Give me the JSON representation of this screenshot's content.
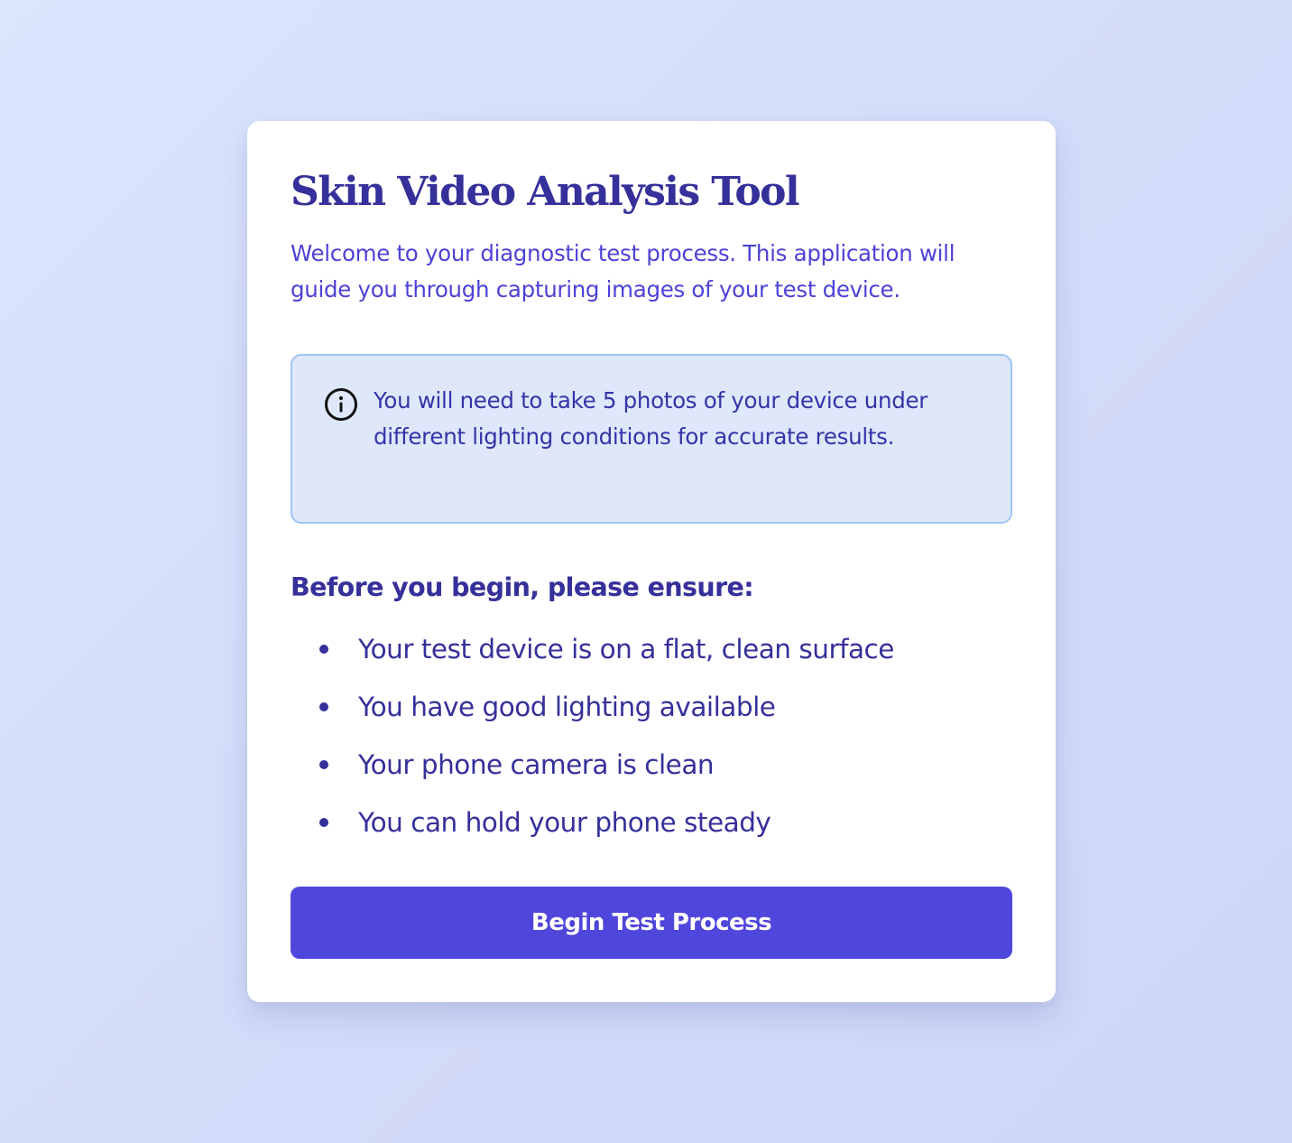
{
  "app": {
    "title": "Skin Video Analysis Tool",
    "subtitle": "Welcome to your diagnostic test process. This application will guide you through capturing images of your test device."
  },
  "info": {
    "icon": "info-circle-icon",
    "text": "You will need to take 5 photos of your device under different lighting conditions for accurate results."
  },
  "checklist": {
    "heading": "Before you begin, please ensure:",
    "items": [
      {
        "label": "Your test device is on a flat, clean surface"
      },
      {
        "label": "You have good lighting available"
      },
      {
        "label": "Your phone camera is clean"
      },
      {
        "label": "You can hold your phone steady"
      }
    ]
  },
  "actions": {
    "begin_label": "Begin Test Process"
  },
  "colors": {
    "primary": "#4f46dc",
    "heading": "#35309a",
    "subtitle": "#4d42d6",
    "info_bg": "#dfe8fb",
    "info_border": "#9cc5f3"
  }
}
